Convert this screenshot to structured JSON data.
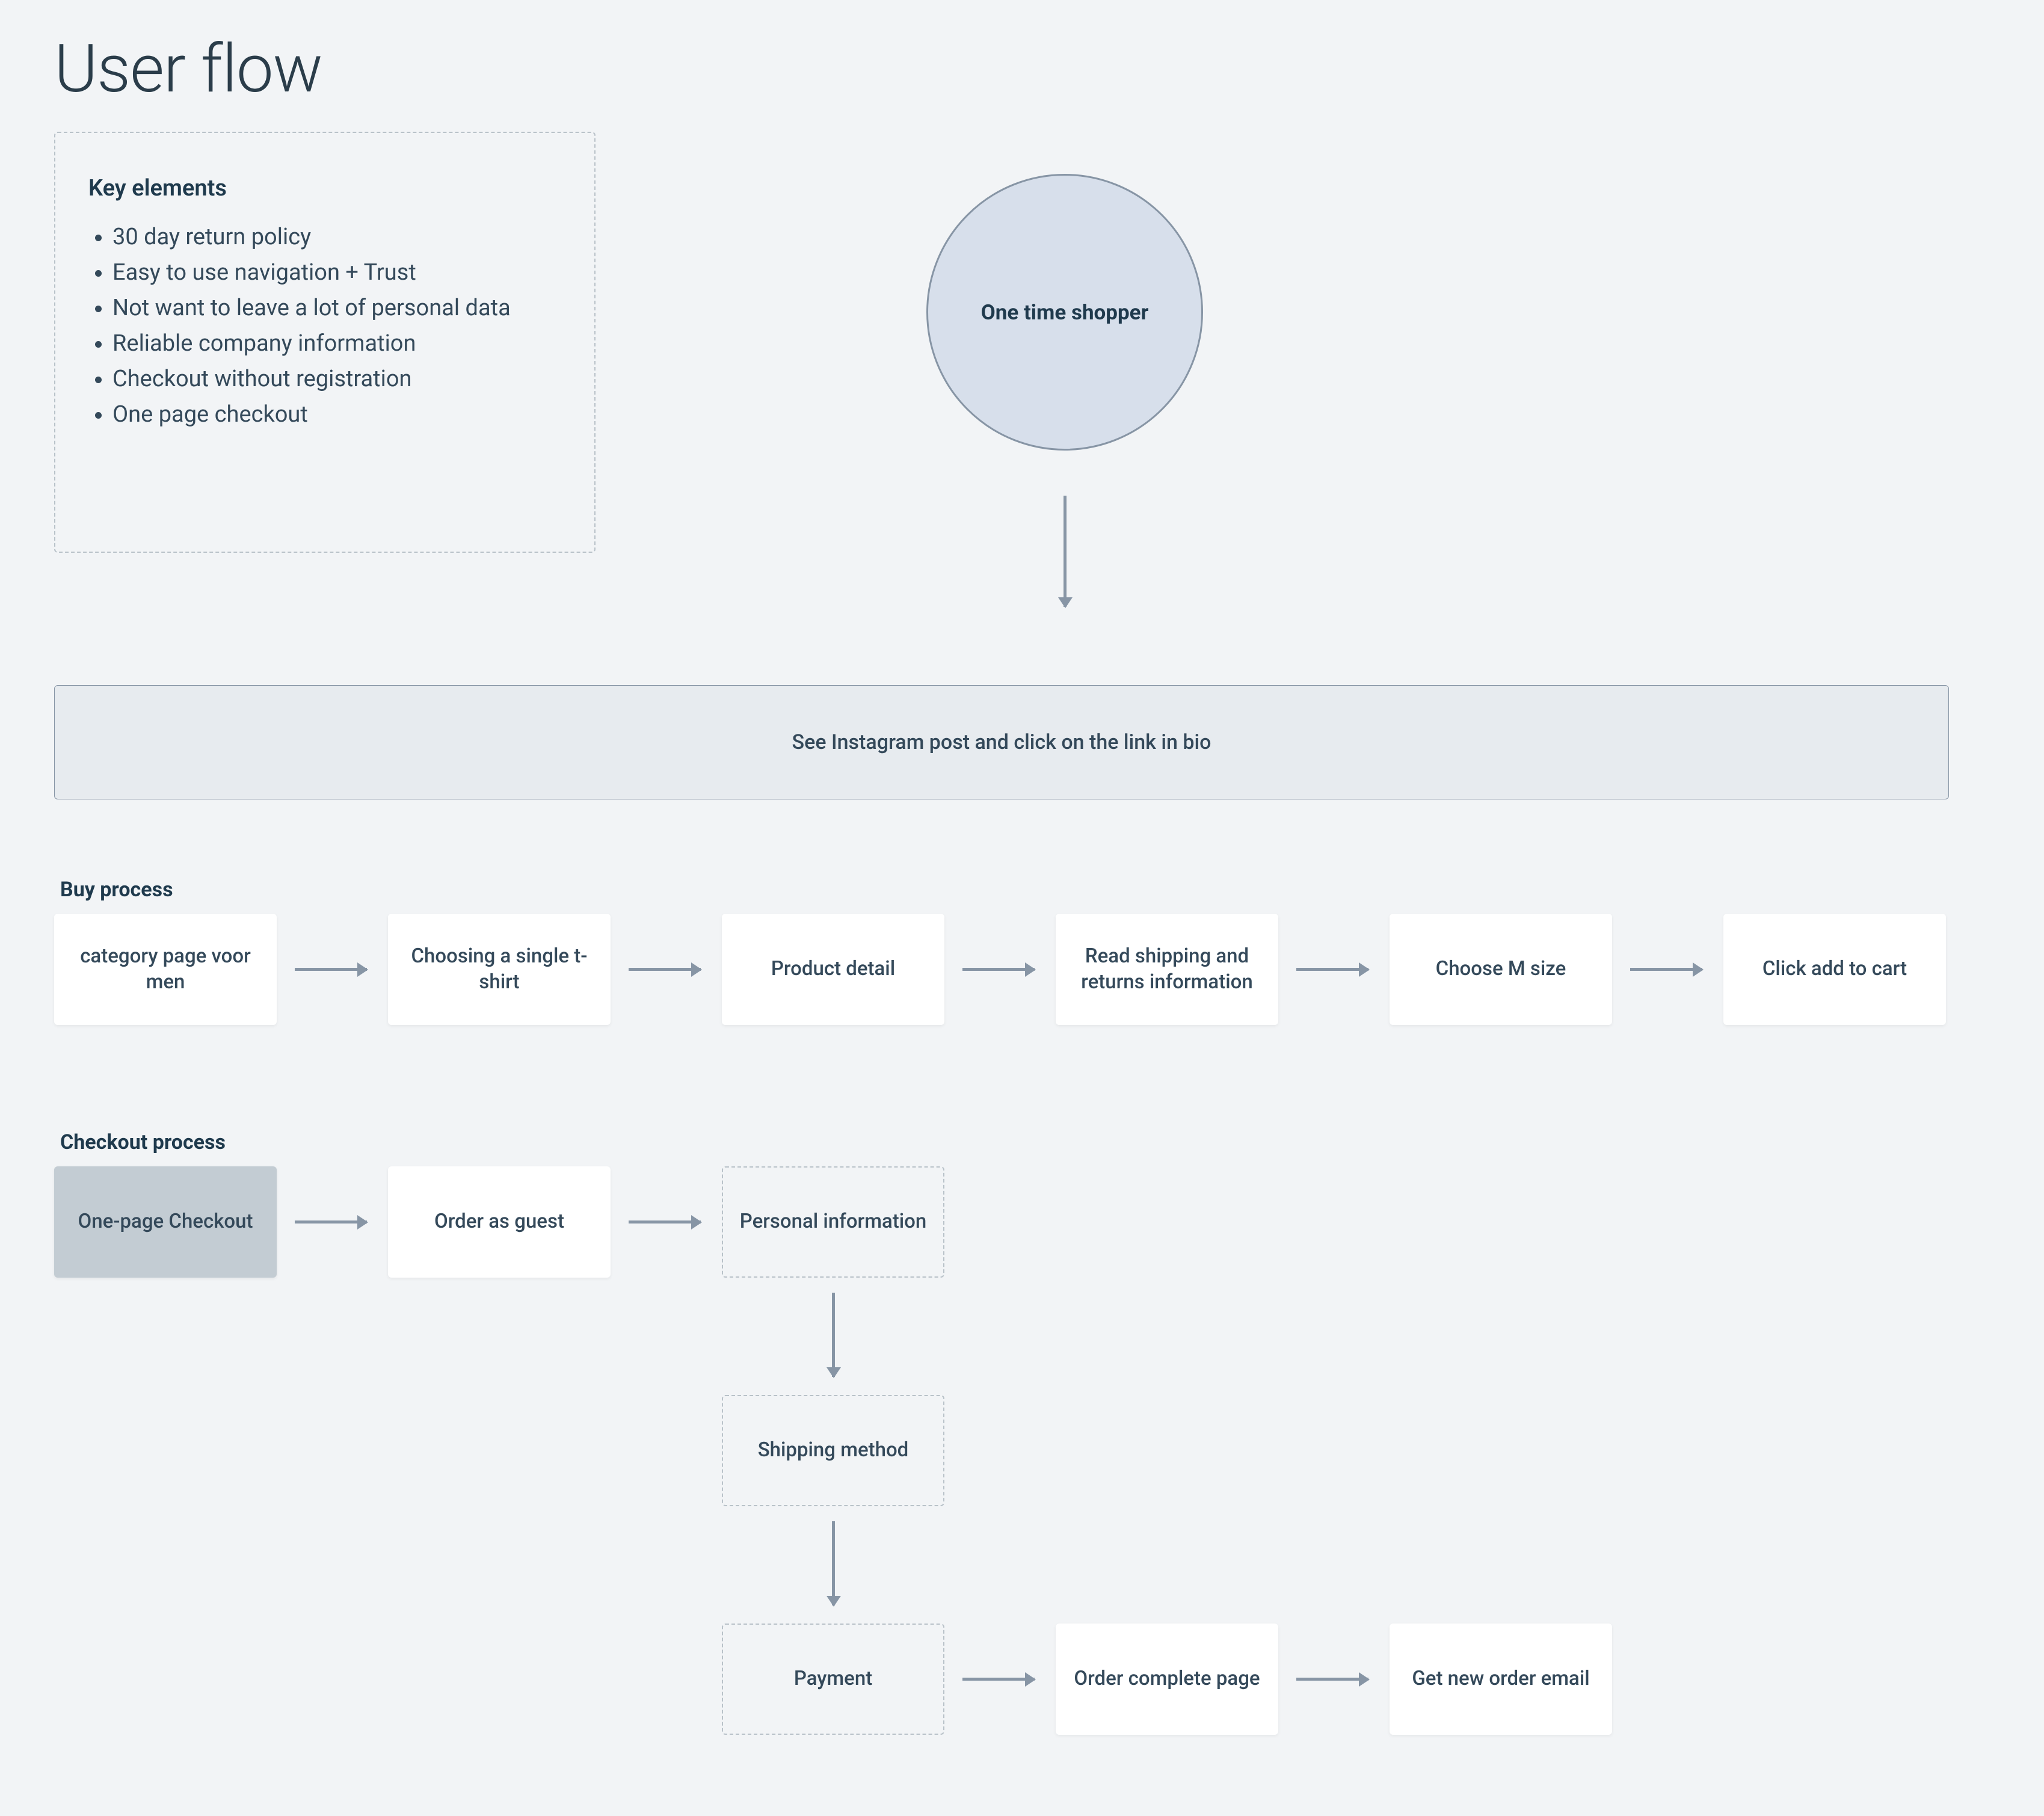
{
  "title": "User flow",
  "key_elements": {
    "heading": "Key elements",
    "items": [
      "30 day return policy",
      "Easy to use navigation + Trust",
      " Not want to leave a lot of personal data",
      "Reliable company information",
      "Checkout without registration",
      "One page checkout"
    ]
  },
  "start_node": "One time shopper",
  "entry_bar": "See Instagram post and click on the link in bio",
  "buy": {
    "heading": "Buy process",
    "steps": [
      "category page voor men",
      "Choosing a single t-shirt",
      "Product detail",
      "Read shipping and returns information",
      "Choose M size",
      "Click add to cart"
    ]
  },
  "checkout": {
    "heading": "Checkout process",
    "steps": [
      "One-page Checkout",
      "Order as guest",
      "Personal information",
      "Shipping method",
      "Payment",
      "Order complete page",
      "Get new order email"
    ]
  }
}
